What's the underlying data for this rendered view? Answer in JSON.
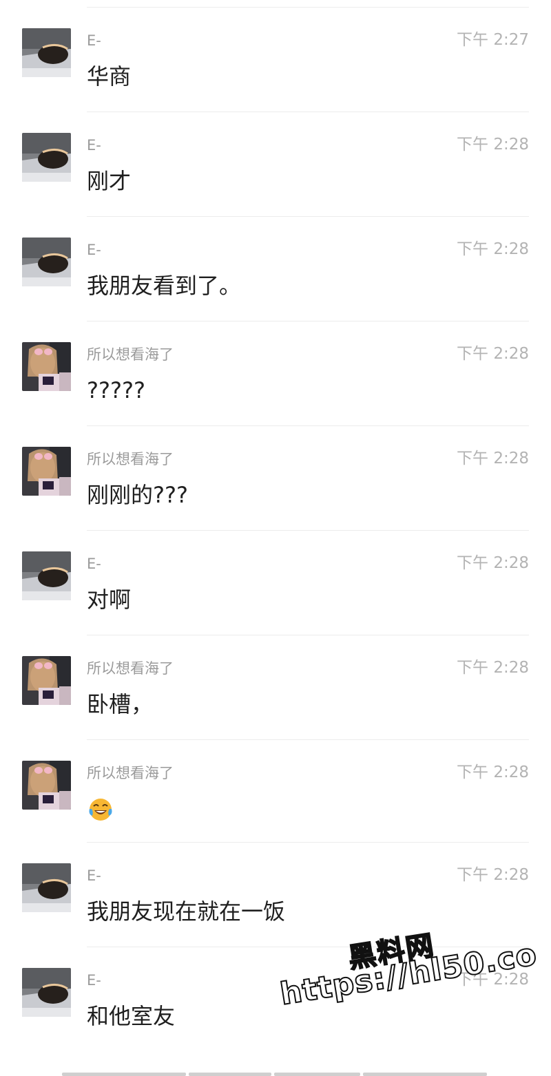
{
  "messages": [
    {
      "sender": "E-",
      "time": "下午 2:27",
      "text": "华商",
      "avatar": "avatar-e"
    },
    {
      "sender": "E-",
      "time": "下午 2:28",
      "text": "刚才",
      "avatar": "avatar-e"
    },
    {
      "sender": "E-",
      "time": "下午 2:28",
      "text": "我朋友看到了。",
      "avatar": "avatar-e"
    },
    {
      "sender": "所以想看海了",
      "time": "下午 2:28",
      "text": "?????",
      "avatar": "avatar-girl"
    },
    {
      "sender": "所以想看海了",
      "time": "下午 2:28",
      "text": "刚刚的???",
      "avatar": "avatar-girl"
    },
    {
      "sender": "E-",
      "time": "下午 2:28",
      "text": "对啊",
      "avatar": "avatar-e"
    },
    {
      "sender": "所以想看海了",
      "time": "下午 2:28",
      "text": "卧槽，",
      "avatar": "avatar-girl"
    },
    {
      "sender": "所以想看海了",
      "time": "下午 2:28",
      "text": "",
      "emoji": "tears-of-joy-emoji",
      "avatar": "avatar-girl"
    },
    {
      "sender": "E-",
      "time": "下午 2:28",
      "text": "我朋友现在就在一饭",
      "avatar": "avatar-e"
    },
    {
      "sender": "E-",
      "time": "下午 2:28",
      "text": "和他室友",
      "avatar": "avatar-e"
    }
  ],
  "watermark": {
    "title": "黑料网",
    "url": "https://hl50.co"
  },
  "colors": {
    "sender": "#9a9a9a",
    "time": "#b3b3b3",
    "text": "#1f1f1f",
    "divider": "#ececec"
  }
}
